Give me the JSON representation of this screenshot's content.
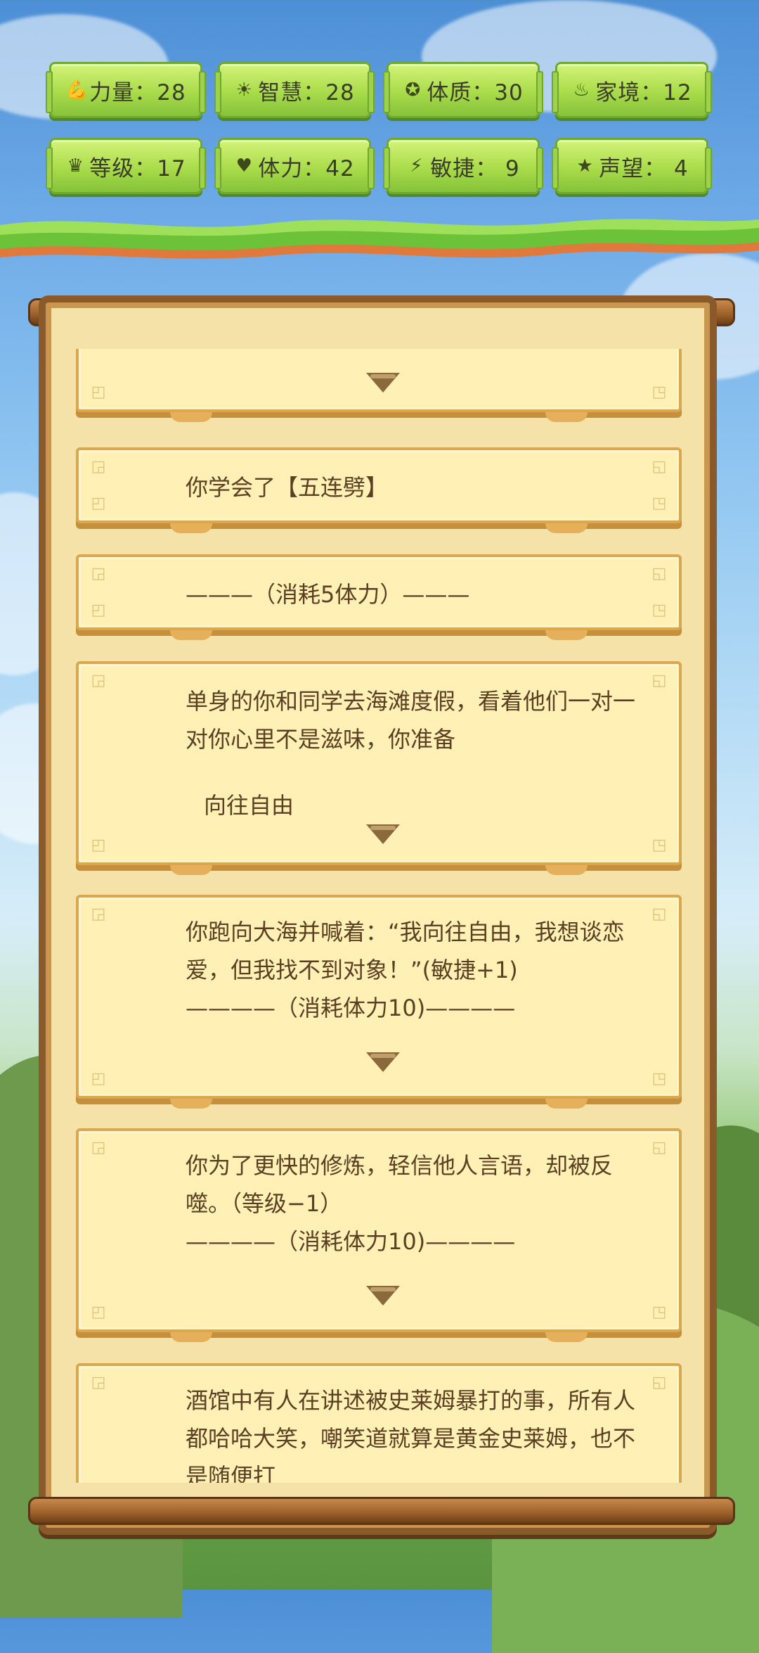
{
  "stats": [
    {
      "icon": "muscle-icon",
      "glyph": "💪",
      "label": "力量：28"
    },
    {
      "icon": "bulb-icon",
      "glyph": "☀",
      "label": "智慧：28"
    },
    {
      "icon": "constitution-icon",
      "glyph": "✪",
      "label": "体质：30"
    },
    {
      "icon": "family-icon",
      "glyph": "♨",
      "label": "家境：12"
    },
    {
      "icon": "crown-icon",
      "glyph": "♛",
      "label": "等级：17"
    },
    {
      "icon": "heart-icon",
      "glyph": "♥",
      "label": "体力：42"
    },
    {
      "icon": "lightning-icon",
      "glyph": "⚡",
      "label": "敏捷：  9"
    },
    {
      "icon": "star-icon",
      "glyph": "★",
      "label": "声望：  4"
    }
  ],
  "log": {
    "top_partial": "",
    "skill_learned": "你学会了【五连劈】",
    "cost_line_1": "———（消耗5体力）———",
    "event_1_text": "单身的你和同学去海滩度假，看着他们一对一对你心里不是滋味，你准备",
    "event_1_choice": "向往自由",
    "event_2_text": "你跑向大海并喊着：“我向往自由，我想谈恋爱，但我找不到对象！”(敏捷+1)",
    "event_2_cost": "————（消耗体力10)————",
    "event_3_text": "你为了更快的修炼，轻信他人言语，却被反噬。（等级−1）",
    "event_3_cost": "————（消耗体力10)————",
    "event_4_text": "酒馆中有人在讲述被史莱姆暴打的事，所有人都哈哈大笑，嘲笑道就算是黄金史莱姆，也不是随便打"
  },
  "colors": {
    "panel_green": "#a9dc4a",
    "parchment": "#fff0b5",
    "wood": "#8a5a2b"
  }
}
